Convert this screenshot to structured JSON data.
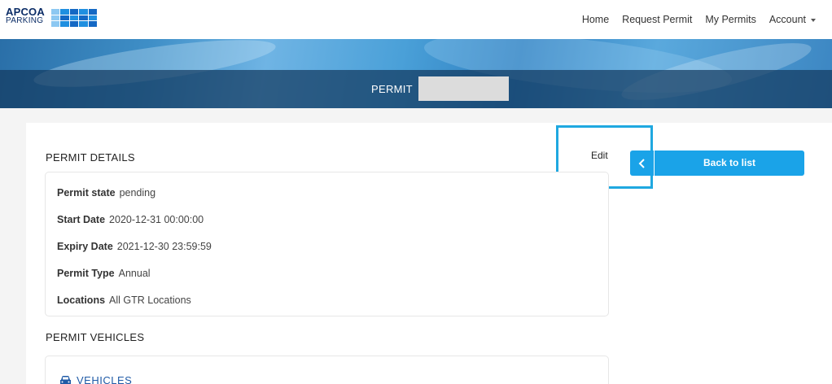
{
  "logo": {
    "brand": "APCOA",
    "sub": "PARKING"
  },
  "nav": {
    "home": "Home",
    "request_permit": "Request Permit",
    "my_permits": "My Permits",
    "account": "Account"
  },
  "banner": {
    "title": "PERMIT"
  },
  "details": {
    "title": "PERMIT DETAILS",
    "edit_label": "Edit",
    "back_label": "Back to list",
    "rows": [
      {
        "label": "Permit state",
        "value": "pending"
      },
      {
        "label": "Start Date",
        "value": "2020-12-31 00:00:00"
      },
      {
        "label": "Expiry Date",
        "value": "2021-12-30 23:59:59"
      },
      {
        "label": "Permit Type",
        "value": "Annual"
      },
      {
        "label": "Locations",
        "value": "All GTR Locations"
      }
    ]
  },
  "vehicles": {
    "title": "PERMIT VEHICLES",
    "card_header": "VEHICLES"
  },
  "colors": {
    "accent": "#1aa3e8",
    "highlight": "#1fa8e0",
    "brand": "#0b2c66"
  }
}
